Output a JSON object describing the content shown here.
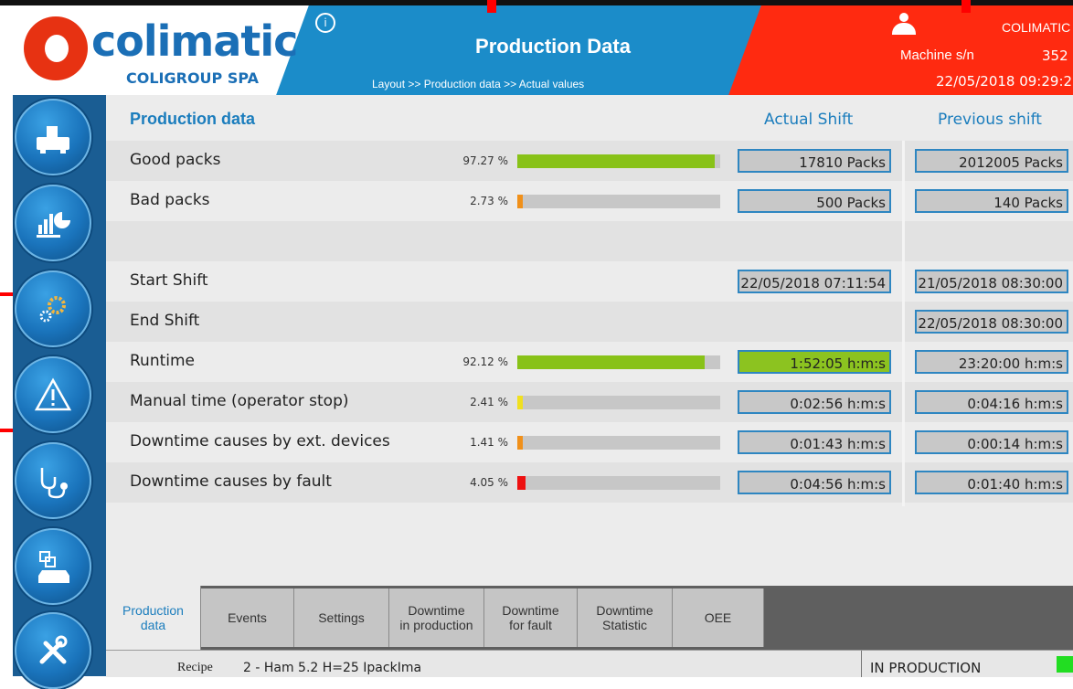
{
  "header": {
    "logo_text": "colimatic",
    "logo_sub": "COLIGROUP SPA",
    "info_glyph": "i",
    "title": "Production Data",
    "breadcrumb": "Layout >> Production data >> Actual values",
    "company": "COLIMATIC",
    "machine_label": "Machine s/n",
    "machine_value": "352",
    "datetime": "22/05/2018 09:29:2",
    "colors": {
      "blue": "#1b8cc9",
      "red": "#ff2a10",
      "accent": "#1b7dbd"
    }
  },
  "sidebar": {
    "items": [
      {
        "name": "machine-icon"
      },
      {
        "name": "statistics-icon"
      },
      {
        "name": "settings-gears-icon"
      },
      {
        "name": "alarm-warning-icon"
      },
      {
        "name": "diagnostics-stethoscope-icon"
      },
      {
        "name": "recipes-archive-icon"
      },
      {
        "name": "maintenance-tools-icon"
      }
    ]
  },
  "table": {
    "section_title": "Production data",
    "col_actual": "Actual Shift",
    "col_previous": "Previous shift",
    "rows": [
      {
        "label": "Good packs",
        "pct": "97.27 %",
        "pct_value": 97.27,
        "bar_color": "#88c218",
        "actual": "17810 Packs",
        "previous": "2012005 Packs"
      },
      {
        "label": "Bad packs",
        "pct": "2.73 %",
        "pct_value": 2.73,
        "bar_color": "#f0901a",
        "actual": "500 Packs",
        "previous": "140 Packs"
      },
      {
        "label": "",
        "pct": "",
        "actual": "",
        "previous": ""
      },
      {
        "label": "Start Shift",
        "pct": "",
        "actual": "22/05/2018 07:11:54",
        "previous": "21/05/2018 08:30:00"
      },
      {
        "label": "End Shift",
        "pct": "",
        "actual": "",
        "previous": "22/05/2018 08:30:00"
      },
      {
        "label": "Runtime",
        "pct": "92.12 %",
        "pct_value": 92.12,
        "bar_color": "#88c218",
        "actual": "1:52:05  h:m:s",
        "previous": "23:20:00  h:m:s",
        "actual_highlight": "#8cc320"
      },
      {
        "label": "Manual time (operator stop)",
        "pct": "2.41 %",
        "pct_value": 2.41,
        "bar_color": "#f0e020",
        "actual": "0:02:56  h:m:s",
        "previous": "0:04:16  h:m:s"
      },
      {
        "label": "Downtime causes by ext. devices",
        "pct": "1.41 %",
        "pct_value": 1.41,
        "bar_color": "#f0901a",
        "actual": "0:01:43  h:m:s",
        "previous": "0:00:14  h:m:s"
      },
      {
        "label": "Downtime causes by fault",
        "pct": "4.05 %",
        "pct_value": 4.05,
        "bar_color": "#ee1111",
        "actual": "0:04:56  h:m:s",
        "previous": "0:01:40  h:m:s"
      }
    ]
  },
  "tabs": [
    {
      "label": "Production\ndata",
      "active": true
    },
    {
      "label": "Events"
    },
    {
      "label": "Settings"
    },
    {
      "label": "Downtime\nin production"
    },
    {
      "label": "Downtime\nfor fault"
    },
    {
      "label": "Downtime\nStatistic"
    },
    {
      "label": "OEE"
    }
  ],
  "status": {
    "recipe_label": "Recipe",
    "recipe_value": "2 - Ham 5.2 H=25 IpackIma",
    "state": "IN PRODUCTION",
    "led_color": "#22dd22"
  }
}
